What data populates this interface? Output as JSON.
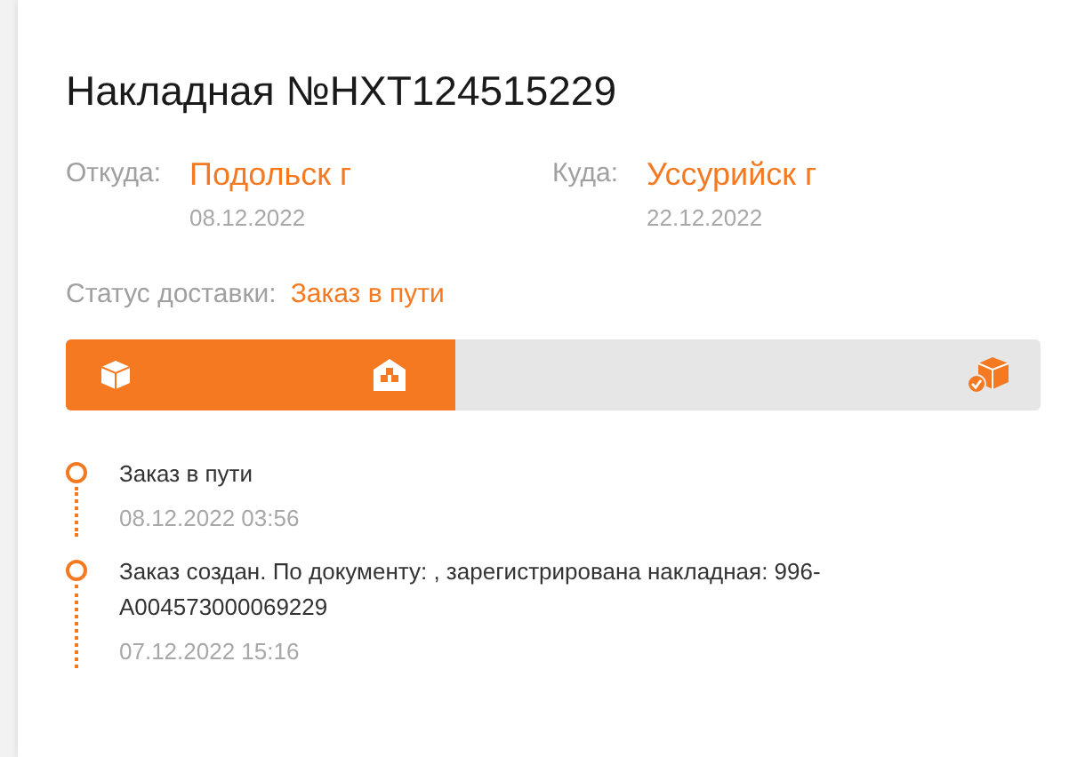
{
  "title": "Накладная №НХТ124515229",
  "route": [
    {
      "label": "Откуда:",
      "city": "Подольск г",
      "date": "08.12.2022"
    },
    {
      "label": "Куда:",
      "city": "Уссурийск г",
      "date": "22.12.2022"
    }
  ],
  "status": {
    "label": "Статус доставки:",
    "value": "Заказ в пути"
  },
  "progress": {
    "level": 0.4,
    "stages": [
      {
        "kind": "box",
        "done": true
      },
      {
        "kind": "warehouse",
        "done": true
      },
      {
        "kind": "delivered",
        "done": false
      }
    ]
  },
  "history": [
    {
      "text": "Заказ в пути",
      "time": "08.12.2022 03:56"
    },
    {
      "text": "Заказ создан. По документу: , зарегистрирована накладная: 996-A004573000069229",
      "time": "07.12.2022 15:16"
    }
  ]
}
